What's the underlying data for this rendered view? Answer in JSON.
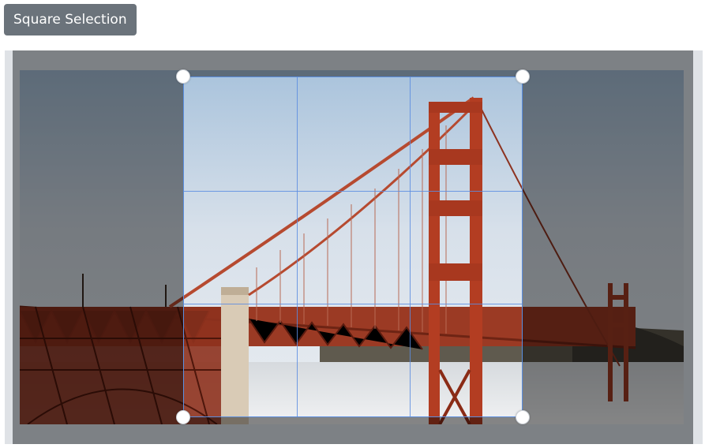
{
  "toolbar": {
    "square_selection_label": "Square Selection"
  },
  "editor": {
    "image_subject": "Golden Gate Bridge photo",
    "overlay_color": "#000000",
    "selection_border_color": "#5b8fe0",
    "handles": [
      "top-left",
      "top-right",
      "bottom-left",
      "bottom-right"
    ]
  }
}
